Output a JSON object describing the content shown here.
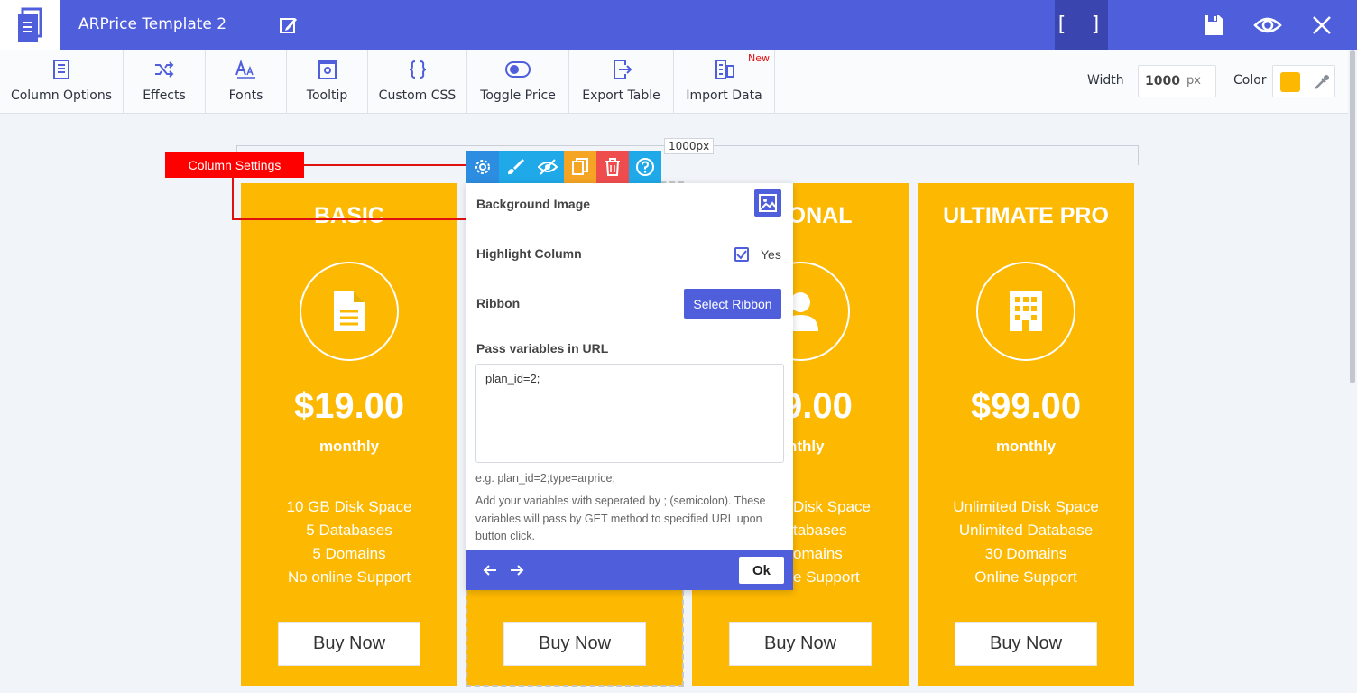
{
  "header": {
    "title": "ARPrice Template 2",
    "expand_label": "[ ]"
  },
  "toolbar": {
    "items": [
      {
        "label": "Column Options",
        "icon": "column-options-icon"
      },
      {
        "label": "Effects",
        "icon": "shuffle-icon"
      },
      {
        "label": "Fonts",
        "icon": "font-icon"
      },
      {
        "label": "Tooltip",
        "icon": "tooltip-icon"
      },
      {
        "label": "Custom CSS",
        "icon": "braces-icon"
      },
      {
        "label": "Toggle Price",
        "icon": "toggle-icon"
      },
      {
        "label": "Export Table",
        "icon": "export-icon"
      },
      {
        "label": "Import Data",
        "icon": "import-icon"
      }
    ],
    "new_badge": "New",
    "width_label": "Width",
    "width_value": "1000",
    "width_unit": "px",
    "color_label": "Color",
    "color_value": "#fdb802"
  },
  "canvas": {
    "ruler_label": "1000px",
    "callout": "Column Settings"
  },
  "columns": [
    {
      "title": "BASIC",
      "price": "$19.00",
      "period": "monthly",
      "features": [
        "10 GB Disk Space",
        "5 Databases",
        "5 Domains",
        "No online Support"
      ],
      "button": "Buy Now",
      "icon": "document-icon"
    },
    {
      "title": "",
      "price": "",
      "period": "",
      "features": [],
      "button": "Buy Now",
      "icon": ""
    },
    {
      "title": "SONAL",
      "price": "9.00",
      "period": "nthly",
      "features": [
        "Disk Space",
        "tabases",
        "omains",
        "e Support"
      ],
      "button": "Buy Now",
      "icon": "user-icon"
    },
    {
      "title": "ULTIMATE PRO",
      "price": "$99.00",
      "period": "monthly",
      "features": [
        "Unlimited Disk Space",
        "Unlimited Database",
        "30 Domains",
        "Online Support"
      ],
      "button": "Buy Now",
      "icon": "building-icon"
    }
  ],
  "popup": {
    "background_image_label": "Background Image",
    "highlight_label": "Highlight Column",
    "highlight_checked": true,
    "highlight_yes": "Yes",
    "ribbon_label": "Ribbon",
    "ribbon_button": "Select Ribbon",
    "url_label": "Pass variables in URL",
    "url_value": "plan_id=2;",
    "hint": "e.g. plan_id=2;type=arprice;",
    "description": "Add your variables with seperated by ; (semicolon). These variables will pass by GET method to specified URL upon button click.",
    "ok_label": "Ok"
  },
  "colors": {
    "brand": "#4f5fdc",
    "column": "#fdb802",
    "callout": "#ff0000"
  }
}
